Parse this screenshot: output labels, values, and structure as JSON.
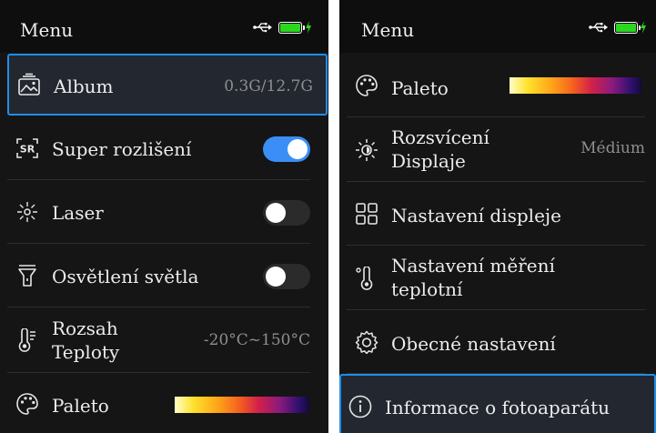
{
  "left_screen": {
    "title": "Menu",
    "items": [
      {
        "icon": "album-icon",
        "label": "Album",
        "value": "0.3G/12.7G",
        "selected": true
      },
      {
        "icon": "super-resolution-icon",
        "icon_text": "SR",
        "label": "Super rozlišení",
        "toggle": "on"
      },
      {
        "icon": "laser-icon",
        "label": "Laser",
        "toggle": "off"
      },
      {
        "icon": "flashlight-icon",
        "label": "Osvětlení světla",
        "toggle": "off"
      },
      {
        "icon": "thermometer-icon",
        "label": "Rozsah Teploty",
        "label_line1": "Rozsah",
        "label_line2": "Teploty",
        "value": "-20°C~150°C"
      },
      {
        "icon": "palette-icon",
        "label": "Paleto",
        "palette": "iron"
      }
    ]
  },
  "right_screen": {
    "title": "Menu",
    "items": [
      {
        "icon": "palette-icon",
        "label": "Paleto",
        "palette": "iron"
      },
      {
        "icon": "brightness-icon",
        "label": "Rozsvícení Displaje",
        "label_line1": "Rozsvícení",
        "label_line2": "Displaje",
        "value": "Médium"
      },
      {
        "icon": "grid-icon",
        "label": "Nastavení displeje"
      },
      {
        "icon": "thermometer-icon",
        "label": "Nastavení měření teplotní",
        "label_line1": "Nastavení měření",
        "label_line2": "teplotní"
      },
      {
        "icon": "gear-icon",
        "label": "Obecné nastavení"
      },
      {
        "icon": "info-icon",
        "label": "Informace o fotoaparátu",
        "selected": true
      }
    ]
  },
  "status": {
    "usb_icon": "usb-icon",
    "battery_icon": "battery-charging-icon",
    "battery_color": "#2bd81f"
  },
  "colors": {
    "background": "#151515",
    "selection_border": "#1f8ee8",
    "selection_bg": "#23272f",
    "toggle_on": "#3a8ef6",
    "toggle_off": "#2b2b2b",
    "value_text": "#8e8e8e"
  }
}
